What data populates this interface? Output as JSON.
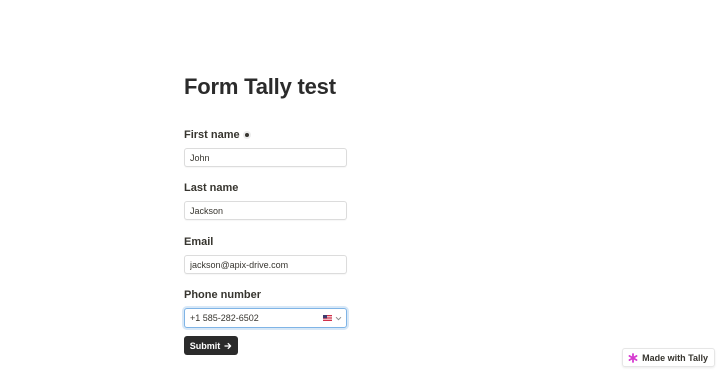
{
  "form": {
    "title": "Form Tally test",
    "fields": [
      {
        "label": "First name",
        "value": "John",
        "required": true
      },
      {
        "label": "Last name",
        "value": "Jackson",
        "required": false
      },
      {
        "label": "Email",
        "value": "jackson@apix-drive.com",
        "required": false
      },
      {
        "label": "Phone number",
        "value": "+1 585-282-6502",
        "required": false,
        "country_flag": "us-flag-icon"
      }
    ],
    "submit_label": "Submit",
    "submit_icon": "arrow-right-icon"
  },
  "badge": {
    "label": "Made with Tally",
    "icon": "tally-logo-icon",
    "icon_color": "#d63bd0"
  },
  "colors": {
    "text": "#37352f",
    "button_bg": "#2b2b2b",
    "focus_border": "#7fb4e6"
  }
}
